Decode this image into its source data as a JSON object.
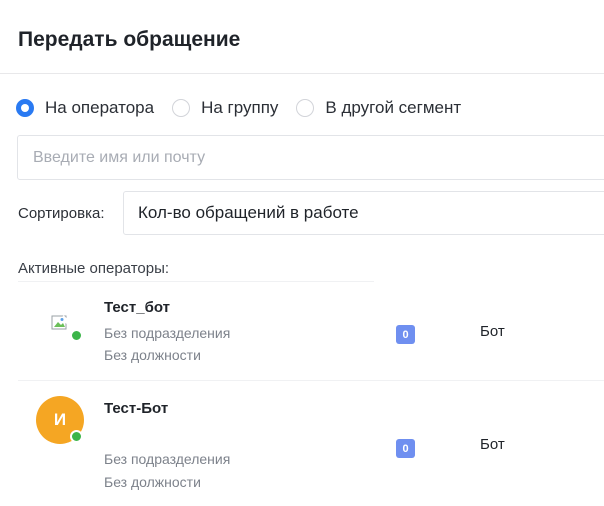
{
  "dialog": {
    "title": "Передать обращение"
  },
  "transfer_options": [
    {
      "label": "На оператора",
      "checked": true
    },
    {
      "label": "На группу",
      "checked": false
    },
    {
      "label": "В другой сегмент",
      "checked": false
    }
  ],
  "search": {
    "placeholder": "Введите имя или почту",
    "value": ""
  },
  "sort": {
    "label": "Сортировка:",
    "selected": "Кол-во обращений в работе"
  },
  "section": {
    "label": "Активные операторы:"
  },
  "operators": [
    {
      "name": "Тест_бот",
      "department": "Без подразделения",
      "position": "Без должности",
      "count": "0",
      "role": "Бот",
      "avatar_type": "broken-image",
      "status": "online"
    },
    {
      "name": "Тест-Бот",
      "department": "Без подразделения",
      "position": "Без должности",
      "count": "0",
      "role": "Бот",
      "avatar_type": "letter",
      "avatar_letter": "И",
      "status": "online"
    }
  ],
  "colors": {
    "accent": "#2a7af2",
    "avatar_orange": "#f5a623",
    "online_green": "#3cb54a",
    "badge_blue": "#6f8ff0"
  }
}
